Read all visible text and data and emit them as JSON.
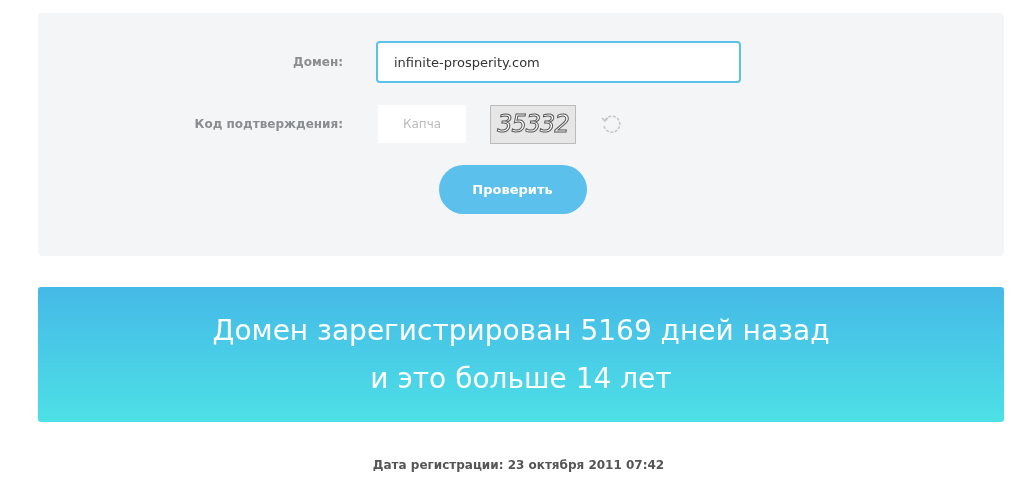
{
  "form": {
    "domain": {
      "label": "Домен:",
      "value": "infinite-prosperity.com"
    },
    "captcha": {
      "label": "Код подтверждения:",
      "placeholder": "Капча",
      "code": "35332"
    },
    "submit": "Проверить"
  },
  "result": {
    "lines": [
      "Домен зарегистрирован 5169 дней назад",
      "и это больше 14 лет"
    ]
  },
  "registration_date": "Дата регистрации: 23 октября 2011 07:42"
}
